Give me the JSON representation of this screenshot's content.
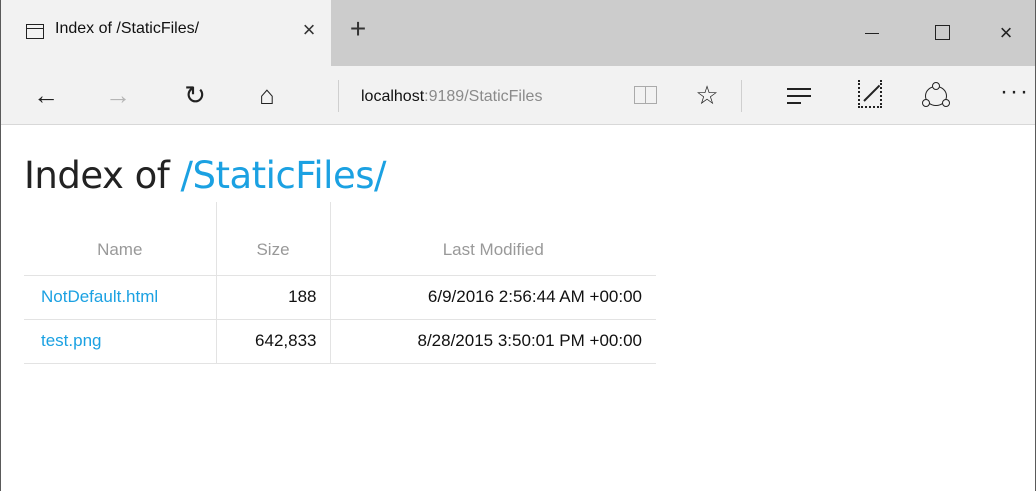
{
  "tab": {
    "title": "Index of /StaticFiles/",
    "favicon_icon": "page-icon",
    "close_label": "×"
  },
  "new_tab_label": "+",
  "window_controls": {
    "close_label": "×"
  },
  "toolbar": {
    "back_label": "←",
    "forward_label": "→",
    "refresh_label": "↻",
    "home_label": "⌂",
    "favorite_label": "☆",
    "more_label": "···",
    "address": {
      "host": "localhost",
      "path": ":9189/StaticFiles"
    }
  },
  "page": {
    "heading_prefix": "Index of ",
    "heading_path": "/StaticFiles/",
    "columns": [
      "Name",
      "Size",
      "Last Modified"
    ],
    "rows": [
      {
        "name": "NotDefault.html",
        "size": "188",
        "modified": "6/9/2016 2:56:44 AM +00:00"
      },
      {
        "name": "test.png",
        "size": "642,833",
        "modified": "8/28/2015 3:50:01 PM +00:00"
      }
    ]
  },
  "colors": {
    "link": "#1ba1e2",
    "tab_bar": "#cccccc",
    "toolbar": "#f2f2f2"
  }
}
